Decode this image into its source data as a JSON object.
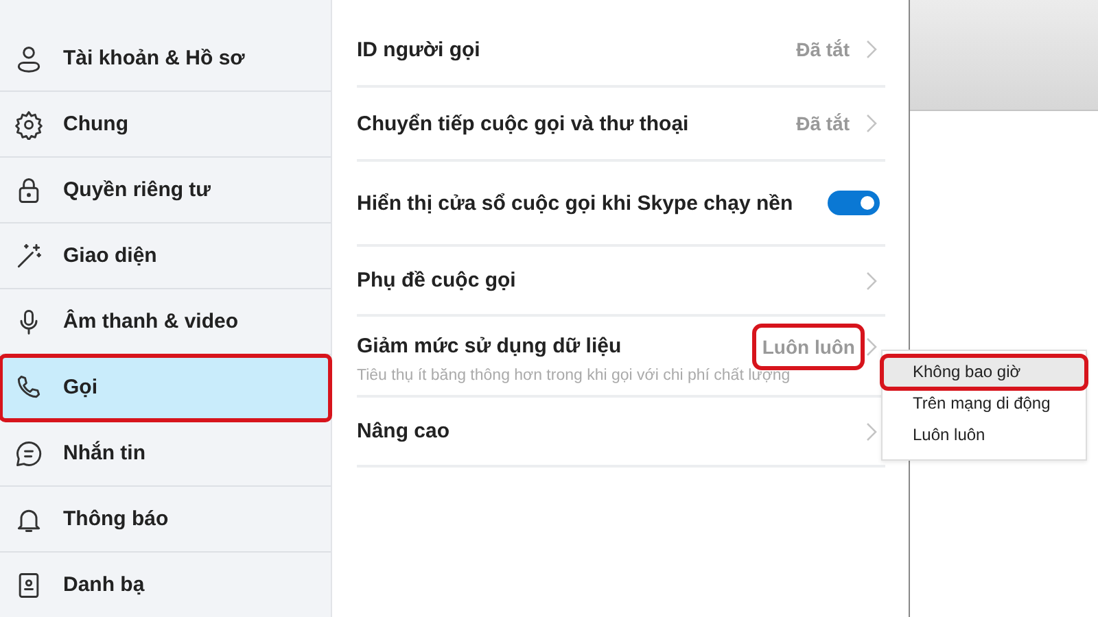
{
  "sidebar": {
    "items": [
      {
        "label": "Tài khoản & Hồ sơ",
        "selected": false,
        "highlighted": false
      },
      {
        "label": "Chung",
        "selected": false,
        "highlighted": false
      },
      {
        "label": "Quyền riêng tư",
        "selected": false,
        "highlighted": false
      },
      {
        "label": "Giao diện",
        "selected": false,
        "highlighted": false
      },
      {
        "label": "Âm thanh & video",
        "selected": false,
        "highlighted": false
      },
      {
        "label": "Gọi",
        "selected": true,
        "highlighted": true
      },
      {
        "label": "Nhắn tin",
        "selected": false,
        "highlighted": false
      },
      {
        "label": "Thông báo",
        "selected": false,
        "highlighted": false
      },
      {
        "label": "Danh bạ",
        "selected": false,
        "highlighted": false
      }
    ]
  },
  "settings": [
    {
      "kind": "link",
      "label": "ID người gọi",
      "value": "Đã tắt",
      "highlighted": false
    },
    {
      "kind": "link",
      "label": "Chuyển tiếp cuộc gọi và thư thoại",
      "value": "Đã tắt",
      "highlighted": false
    },
    {
      "kind": "toggle",
      "label": "Hiển thị cửa sổ cuộc gọi khi Skype chạy nền",
      "on": true
    },
    {
      "kind": "link",
      "label": "Phụ đề cuộc gọi"
    },
    {
      "kind": "dropdown",
      "label": "Giảm mức sử dụng dữ liệu",
      "value": "Luôn luôn",
      "description": "Tiêu thụ ít băng thông hơn trong khi gọi với chi phí chất lượng",
      "highlighted": true
    },
    {
      "kind": "link",
      "label": "Nâng cao"
    }
  ],
  "dropdown_menu": {
    "options": [
      {
        "label": "Không bao giờ",
        "hovered": true,
        "highlighted": true
      },
      {
        "label": "Trên mạng di động",
        "hovered": false,
        "highlighted": false
      },
      {
        "label": "Luôn luôn",
        "hovered": false,
        "highlighted": false
      }
    ]
  }
}
